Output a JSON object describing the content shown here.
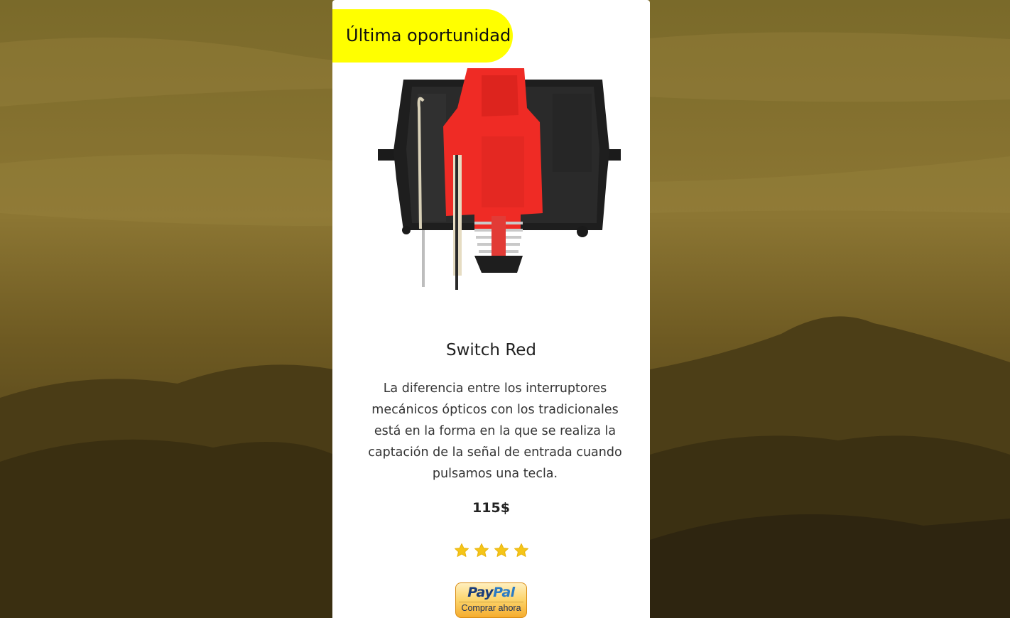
{
  "badge": {
    "label": "Última oportunidad"
  },
  "product": {
    "title": "Switch Red",
    "description": "La diferencia entre los interruptores mecánicos ópticos con los tradicionales está en la forma en la que se realiza la captación de la señal de entrada cuando pulsamos una tecla.",
    "price": "115$",
    "rating": 4,
    "rating_max": 4,
    "image_icon": "mechanical-switch-cutaway"
  },
  "paypal": {
    "logo_pay": "Pay",
    "logo_pal": "Pal",
    "label": "Comprar ahora"
  },
  "colors": {
    "badge": "#ffff00",
    "star": "#f5c518",
    "switch_red": "#ef2b25",
    "background_tint": "#6b5a22"
  }
}
